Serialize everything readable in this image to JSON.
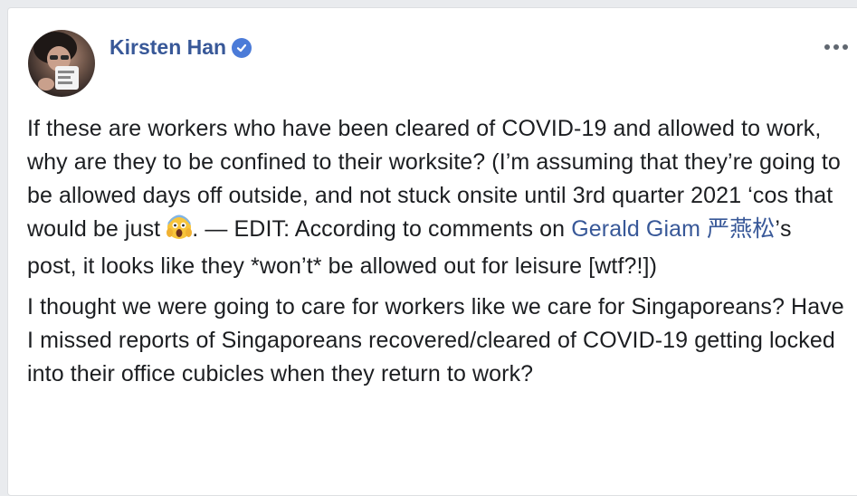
{
  "post": {
    "author": "Kirsten Han",
    "verified_icon": "verified-badge-icon",
    "more_icon": "more-options-icon",
    "paragraph1": {
      "part1": "If these are workers who have been cleared of COVID-19 and allowed to work, why are they to be confined to their worksite? (I’m assuming that they’re going to be allowed days off outside, and not stuck onsite until 3rd quarter 2021 ‘cos that would be just ",
      "emoji": "screaming-face-emoji",
      "part2": ". — EDIT: According to comments on ",
      "mention": "Gerald Giam 严燕松",
      "part3": "’s post, it looks like they *won’t* be allowed out for leisure [wtf?!])"
    },
    "paragraph2": "I thought we were going to care for workers like we care for Singaporeans? Have I missed reports of Singaporeans recovered/cleared of COVID-19 getting locked into their office cubicles when they return to work?"
  },
  "colors": {
    "link": "#385898",
    "text": "#1c1e21",
    "verified": "#4b7bd8"
  }
}
